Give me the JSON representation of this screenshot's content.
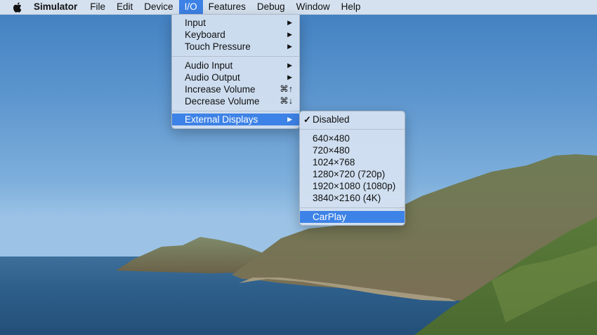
{
  "menubar": {
    "apple_icon": "apple-logo-icon",
    "app_name": "Simulator",
    "items": [
      "File",
      "Edit",
      "Device",
      "I/O",
      "Features",
      "Debug",
      "Window",
      "Help"
    ],
    "active_item": "I/O"
  },
  "io_menu": {
    "input": "Input",
    "keyboard": "Keyboard",
    "touch_pressure": "Touch Pressure",
    "audio_input": "Audio Input",
    "audio_output": "Audio Output",
    "increase_volume": "Increase Volume",
    "increase_volume_shortcut": "⌘↑",
    "decrease_volume": "Decrease Volume",
    "decrease_volume_shortcut": "⌘↓",
    "external_displays": "External Displays",
    "submenu_arrow": "▶"
  },
  "external_displays_menu": {
    "checkmark": "✓",
    "disabled": "Disabled",
    "resolutions": [
      "640×480",
      "720×480",
      "1024×768",
      "1280×720 (720p)",
      "1920×1080 (1080p)",
      "3840×2160 (4K)"
    ],
    "carplay": "CarPlay",
    "selected": "Disabled",
    "highlighted": "CarPlay"
  },
  "colors": {
    "highlight": "#3d82e6",
    "menu_bg": "#d4e1f1"
  }
}
